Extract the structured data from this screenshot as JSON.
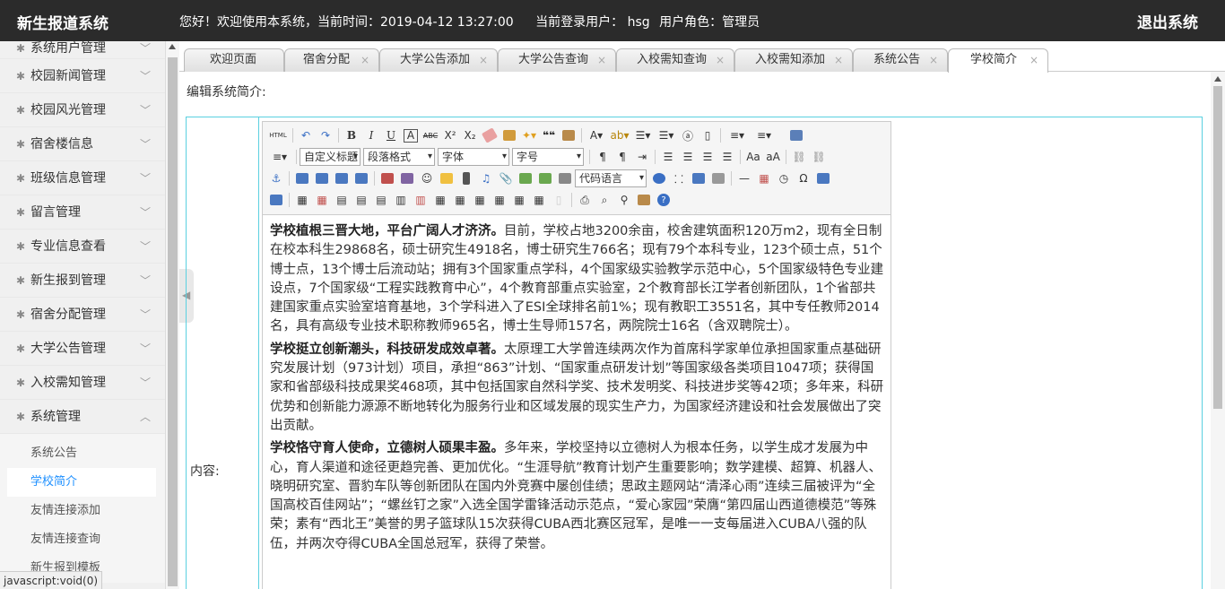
{
  "header": {
    "app_title": "新生报道系统",
    "greeting": "您好！欢迎使用本系统，当前时间：2019-04-12 13:27:00",
    "user_text": "当前登录用户： hsg",
    "role_text": "用户角色：管理员",
    "logout_label": "退出系统"
  },
  "sidebar": {
    "items": [
      {
        "label": "系统用户管理"
      },
      {
        "label": "校园新闻管理"
      },
      {
        "label": "校园风光管理"
      },
      {
        "label": "宿舍楼信息"
      },
      {
        "label": "班级信息管理"
      },
      {
        "label": "留言管理"
      },
      {
        "label": "专业信息查看"
      },
      {
        "label": "新生报到管理"
      },
      {
        "label": "宿舍分配管理"
      },
      {
        "label": "大学公告管理"
      },
      {
        "label": "入校需知管理"
      },
      {
        "label": "系统管理"
      }
    ],
    "sub_items": [
      {
        "label": "系统公告"
      },
      {
        "label": "学校简介"
      },
      {
        "label": "友情连接添加"
      },
      {
        "label": "友情连接查询"
      },
      {
        "label": "新生报到模板"
      }
    ]
  },
  "tabs": [
    {
      "label": "欢迎页面"
    },
    {
      "label": "宿舍分配"
    },
    {
      "label": "大学公告添加"
    },
    {
      "label": "大学公告查询"
    },
    {
      "label": "入校需知查询"
    },
    {
      "label": "入校需知添加"
    },
    {
      "label": "系统公告"
    },
    {
      "label": "学校简介"
    }
  ],
  "tab_close": "×",
  "main": {
    "page_label": "编辑系统简介:",
    "field_label": "内容:"
  },
  "editor": {
    "toolbar": {
      "html": "HTML",
      "bold": "B",
      "italic": "I",
      "underline": "U",
      "fontborder": "A",
      "strike": "ABC",
      "sup": "X²",
      "sub": "X₂",
      "blockquote": "❝❝",
      "custom_title": "自定义标题",
      "para_format": "段落格式",
      "font_family": "字体",
      "font_size": "字号",
      "code_lang": "代码语言",
      "omega": "Ω"
    },
    "paragraphs": [
      {
        "lead": "学校植根三晋大地，平台广阔人才济济。",
        "text": "目前，学校占地3200余亩，校舍建筑面积120万m2，现有全日制在校本科生29868名，硕士研究生4918名，博士研究生766名；现有79个本科专业，123个硕士点，51个博士点，13个博士后流动站；拥有3个国家重点学科，4个国家级实验教学示范中心，5个国家级特色专业建设点，7个国家级“工程实践教育中心”，4个教育部重点实验室，2个教育部长江学者创新团队，1个省部共建国家重点实验室培育基地，3个学科进入了ESI全球排名前1%；现有教职工3551名，其中专任教师2014名，具有高级专业技术职称教师965名，博士生导师157名，两院院士16名（含双聘院士）。"
      },
      {
        "lead": "学校挺立创新潮头，科技研发成效卓著。",
        "text": "太原理工大学曾连续两次作为首席科学家单位承担国家重点基础研究发展计划（973计划）项目，承担“863”计划、“国家重点研发计划”等国家级各类项目1047项；获得国家和省部级科技成果奖468项，其中包括国家自然科学奖、技术发明奖、科技进步奖等42项；多年来，科研优势和创新能力源源不断地转化为服务行业和区域发展的现实生产力，为国家经济建设和社会发展做出了突出贡献。"
      },
      {
        "lead": "学校恪守育人使命，立德树人硕果丰盈。",
        "text": "多年来，学校坚持以立德树人为根本任务，以学生成才发展为中心，育人渠道和途径更趋完善、更加优化。“生涯导航”教育计划产生重要影响；数学建模、超算、机器人、晓明研究室、晋豹车队等创新团队在国内外竞赛中屡创佳绩；思政主题网站“清泽心雨”连续三届被评为“全国高校百佳网站”；“螺丝钉之家”入选全国学雷锋活动示范点，“爱心家园”荣膺“第四届山西道德模范”等殊荣；素有“西北王”美誉的男子篮球队15次获得CUBA西北赛区冠军，是唯一一支每届进入CUBA八强的队伍，并两次夺得CUBA全国总冠军，获得了荣誉。"
      }
    ]
  },
  "status_bar": "javascript:void(0)",
  "colors": {
    "header_bg": "#2b2b2b",
    "accent": "#1e90ff",
    "form_border": "#5ad0e0"
  }
}
